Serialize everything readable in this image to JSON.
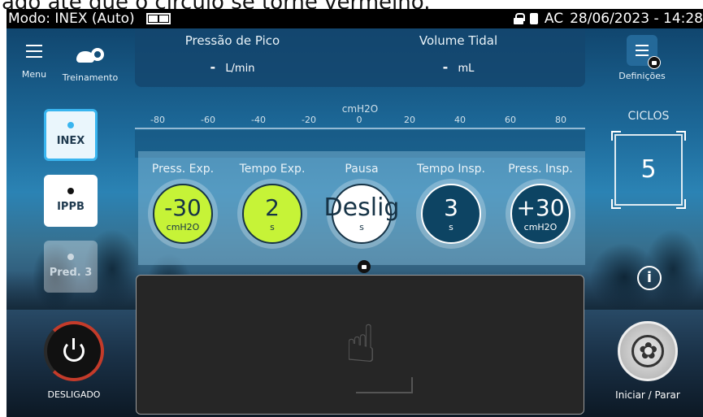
{
  "instruction": {
    "text": "ado   até que o círculo se torne vermelho."
  },
  "statusbar": {
    "mode": "Modo: INEX (Auto)",
    "power": "AC",
    "datetime": "28/06/2023 - 14:28"
  },
  "nav": {
    "menu_label": "Menu",
    "training_label": "Treinamento",
    "settings_label": "Definições"
  },
  "measures": {
    "peak_pressure": {
      "title": "Pressão de Pico",
      "value": "-",
      "unit": "L/min"
    },
    "tidal_volume": {
      "title": "Volume Tidal",
      "value": "-",
      "unit": "mL"
    }
  },
  "scale": {
    "unit": "cmH2O",
    "ticks": [
      "-80",
      "-60",
      "-40",
      "-20",
      "0",
      "20",
      "40",
      "60",
      "80"
    ]
  },
  "modes": [
    {
      "label": "INEX",
      "state": "active"
    },
    {
      "label": "IPPB",
      "state": "normal"
    },
    {
      "label": "Pred. 3",
      "state": "disabled"
    }
  ],
  "params": [
    {
      "label": "Press. Exp.",
      "value": "-30",
      "unit": "cmH2O",
      "style": "green"
    },
    {
      "label": "Tempo Exp.",
      "value": "2",
      "unit": "s",
      "style": "green"
    },
    {
      "label": "Pausa",
      "value": "Deslig",
      "unit": "s",
      "style": "white"
    },
    {
      "label": "Tempo Insp.",
      "value": "3",
      "unit": "s",
      "style": "navy"
    },
    {
      "label": "Press. Insp.",
      "value": "+30",
      "unit": "cmH2O",
      "style": "navy"
    }
  ],
  "cycles": {
    "label": "CICLOS",
    "value": "5"
  },
  "power": {
    "label": "DESLIGADO"
  },
  "start": {
    "label": "Iniciar / Parar"
  },
  "info_symbol": "i",
  "hand_symbol": "☝",
  "colors": {
    "accent_green": "#c6f337",
    "accent_navy": "#0d4463",
    "active_blue": "#39b5ef",
    "power_red": "#c43b2a"
  }
}
